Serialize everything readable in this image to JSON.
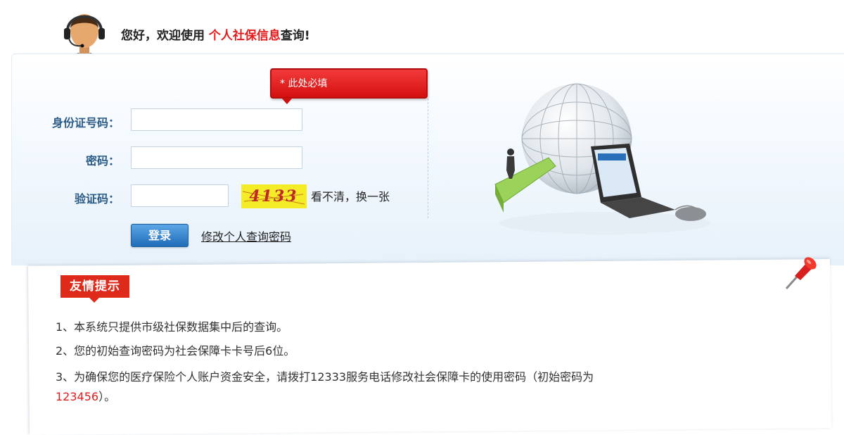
{
  "header": {
    "greeting_prefix": "您好，欢迎使用 ",
    "greeting_highlight": "个人社保信息",
    "greeting_suffix": "查询!"
  },
  "login": {
    "id_label": "身份证号码：",
    "password_label": "密码：",
    "captcha_label": "验证码：",
    "id_value": "",
    "password_value": "",
    "captcha_value": "",
    "captcha_image_text": "4133",
    "refresh_captcha_text": "看不清，换一张",
    "submit_label": "登录",
    "change_password_link": "修改个人查询密码",
    "required_tooltip": "* 此处必填"
  },
  "notice": {
    "tag": "友情提示",
    "tip1": "1、本系统只提供市级社保数据集中后的查询。",
    "tip2": "2、您的初始查询密码为社会保障卡卡号后6位。",
    "tip3_main": "3、为确保您的医疗保险个人账户资金安全，请拨打12333服务电话修改社会保障卡的使用密码（初始密码为",
    "tip3_red": "123456",
    "tip3_end": "）。"
  },
  "colors": {
    "accent_red": "#e21c1c",
    "label_blue": "#2c5b88",
    "button_blue": "#1f6db8"
  },
  "icons": [
    "customer-service-avatar",
    "globe-keyboard-illustration",
    "push-pin-icon"
  ]
}
